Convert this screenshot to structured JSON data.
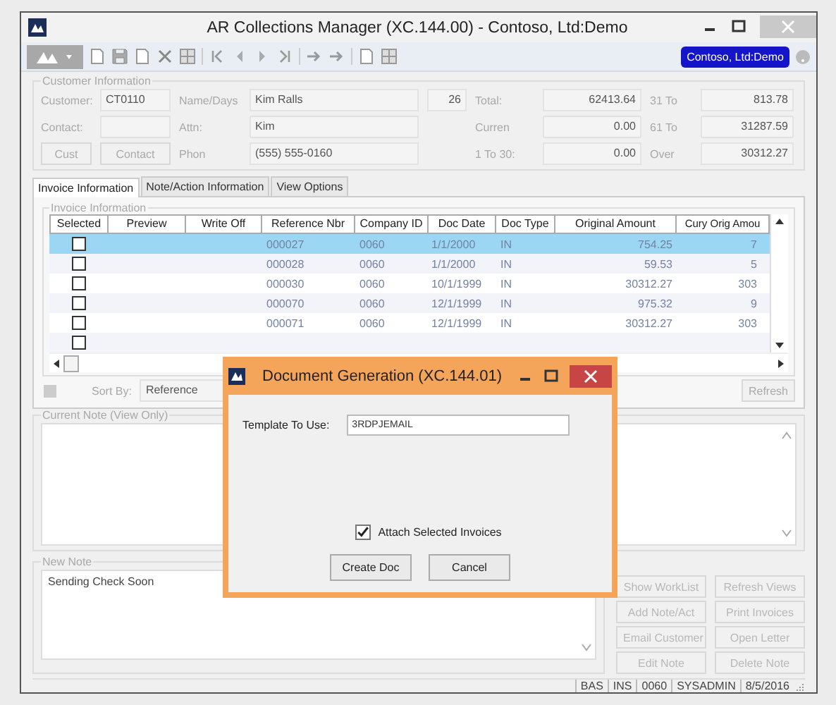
{
  "window": {
    "title": "AR Collections Manager (XC.144.00) - Contoso, Ltd:Demo"
  },
  "company_badge": "Contoso, Ltd:Demo",
  "customer_info": {
    "title": "Customer Information",
    "rows": [
      [
        {
          "kind": "label",
          "text": "Customer:"
        },
        {
          "kind": "field",
          "value": "CT0110"
        },
        {
          "kind": "label",
          "text": "Name/Days"
        },
        {
          "kind": "field",
          "value": "Kim Ralls"
        },
        {
          "kind": "amount",
          "value": "26"
        },
        {
          "kind": "label",
          "text": "Total:"
        },
        {
          "kind": "amount",
          "value": "62413.64"
        },
        {
          "kind": "label",
          "text": "31 To"
        },
        {
          "kind": "amount",
          "value": "813.78"
        }
      ],
      [
        {
          "kind": "label",
          "text": "Contact:"
        },
        {
          "kind": "field"
        },
        {
          "kind": "label",
          "text": "Attn:"
        },
        {
          "kind": "field",
          "value": "Kim"
        },
        {
          "kind": "blank"
        },
        {
          "kind": "label",
          "text": "Curren"
        },
        {
          "kind": "amount",
          "value": "0.00"
        },
        {
          "kind": "label",
          "text": "61 To"
        },
        {
          "kind": "amount",
          "value": "31287.59"
        }
      ],
      [
        {
          "kind": "button",
          "text": "Cust"
        },
        {
          "kind": "button",
          "text": "Contact"
        },
        {
          "kind": "label",
          "text": "Phon"
        },
        {
          "kind": "field",
          "value": "(555) 555-0160"
        },
        {
          "kind": "blank"
        },
        {
          "kind": "label",
          "text": "1 To 30:"
        },
        {
          "kind": "amount",
          "value": "0.00"
        },
        {
          "kind": "label",
          "text": "Over"
        },
        {
          "kind": "amount",
          "value": "30312.27"
        }
      ]
    ]
  },
  "tabs": [
    {
      "label": "Invoice Information",
      "selected": true
    },
    {
      "label": "Note/Action Information",
      "selected": false
    },
    {
      "label": "View Options",
      "selected": false
    }
  ],
  "invoice_group": {
    "title": "Invoice Information"
  },
  "table": {
    "columns": [
      "Selected",
      "Preview",
      "Write Off",
      "Reference Nbr",
      "Company ID",
      "Doc Date",
      "Doc Type",
      "Original Amount",
      "Cury Orig Amou"
    ],
    "rows": [
      {
        "selected": true,
        "checked": false,
        "cells": [
          "000027",
          "0060",
          "1/1/2000",
          "IN",
          "754.25",
          "7"
        ]
      },
      {
        "selected": false,
        "checked": false,
        "cells": [
          "000028",
          "0060",
          "1/1/2000",
          "IN",
          "59.53",
          "5"
        ]
      },
      {
        "selected": false,
        "checked": false,
        "cells": [
          "000030",
          "0060",
          "10/1/1999",
          "IN",
          "30312.27",
          "303"
        ]
      },
      {
        "selected": false,
        "checked": false,
        "cells": [
          "000070",
          "0060",
          "12/1/1999",
          "IN",
          "975.32",
          "9"
        ]
      },
      {
        "selected": false,
        "checked": false,
        "cells": [
          "000071",
          "0060",
          "12/1/1999",
          "IN",
          "30312.27",
          "303"
        ]
      },
      {
        "selected": false,
        "checked": false
      }
    ]
  },
  "sort": {
    "label": "Sort By:",
    "value": "Reference",
    "refresh": "Refresh"
  },
  "current_note": {
    "title": "Current Note (View Only)"
  },
  "new_note": {
    "title": "New Note",
    "value": "Sending Check Soon"
  },
  "actions": [
    {
      "label": "Show WorkList",
      "disabled": true
    },
    {
      "label": "Refresh Views",
      "disabled": true
    },
    {
      "label": "Add Note/Act",
      "disabled": true
    },
    {
      "label": "Print Invoices",
      "disabled": true
    },
    {
      "label": "Email Customer",
      "disabled": true
    },
    {
      "label": "Open Letter",
      "disabled": true
    },
    {
      "label": "Edit Note",
      "disabled": true
    },
    {
      "label": "Delete Note",
      "disabled": true
    }
  ],
  "status_bar": [
    "BAS",
    "INS",
    "0060",
    "SYSADMIN",
    "8/5/2016"
  ],
  "dialog": {
    "title": "Document Generation (XC.144.01)",
    "template_label": "Template To Use:",
    "template_value": "3RDPJEMAIL",
    "attach": {
      "label": "Attach Selected Invoices",
      "checked": true
    },
    "buttons": [
      "Create Doc",
      "Cancel"
    ]
  }
}
